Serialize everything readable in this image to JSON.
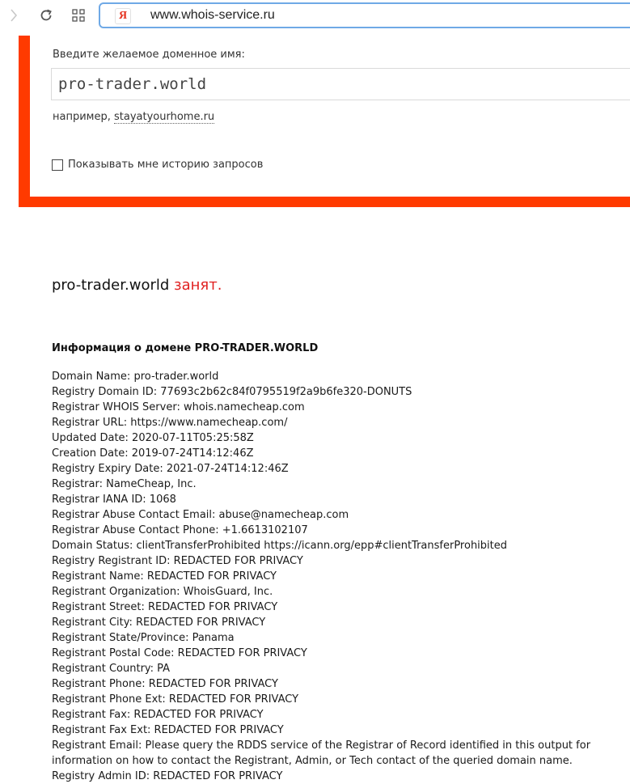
{
  "browser": {
    "url": "www.whois-service.ru",
    "logo_letter": "Я"
  },
  "search": {
    "label": "Введите желаемое доменное имя:",
    "value": "pro-trader.world",
    "example_prefix": "например,",
    "example_link": "stayatyourhome.ru",
    "history_label": "Показывать мне историю запросов"
  },
  "result": {
    "domain": "pro-trader.world",
    "status": "занят."
  },
  "info": {
    "heading": "Информация о домене PRO-TRADER.WORLD",
    "lines": [
      "Domain Name: pro-trader.world",
      "Registry Domain ID: 77693c2b62c84f0795519f2a9b6fe320-DONUTS",
      "Registrar WHOIS Server: whois.namecheap.com",
      "Registrar URL: https://www.namecheap.com/",
      "Updated Date: 2020-07-11T05:25:58Z",
      "Creation Date: 2019-07-24T14:12:46Z",
      "Registry Expiry Date: 2021-07-24T14:12:46Z",
      "Registrar: NameCheap, Inc.",
      "Registrar IANA ID: 1068",
      "Registrar Abuse Contact Email: abuse@namecheap.com",
      "Registrar Abuse Contact Phone: +1.6613102107",
      "Domain Status: clientTransferProhibited https://icann.org/epp#clientTransferProhibited",
      "Registry Registrant ID: REDACTED FOR PRIVACY",
      "Registrant Name: REDACTED FOR PRIVACY",
      "Registrant Organization: WhoisGuard, Inc.",
      "Registrant Street: REDACTED FOR PRIVACY",
      "Registrant City: REDACTED FOR PRIVACY",
      "Registrant State/Province: Panama",
      "Registrant Postal Code: REDACTED FOR PRIVACY",
      "Registrant Country: PA",
      "Registrant Phone: REDACTED FOR PRIVACY",
      "Registrant Phone Ext: REDACTED FOR PRIVACY",
      "Registrant Fax: REDACTED FOR PRIVACY",
      "Registrant Fax Ext: REDACTED FOR PRIVACY",
      "Registrant Email: Please query the RDDS service of the Registrar of Record identified in this output for information on how to contact the Registrant, Admin, or Tech contact of the queried domain name.",
      "Registry Admin ID: REDACTED FOR PRIVACY"
    ]
  },
  "colors": {
    "accent_red": "#ff3a00",
    "status_red": "#e02020",
    "address_border": "#6fa9e6"
  }
}
